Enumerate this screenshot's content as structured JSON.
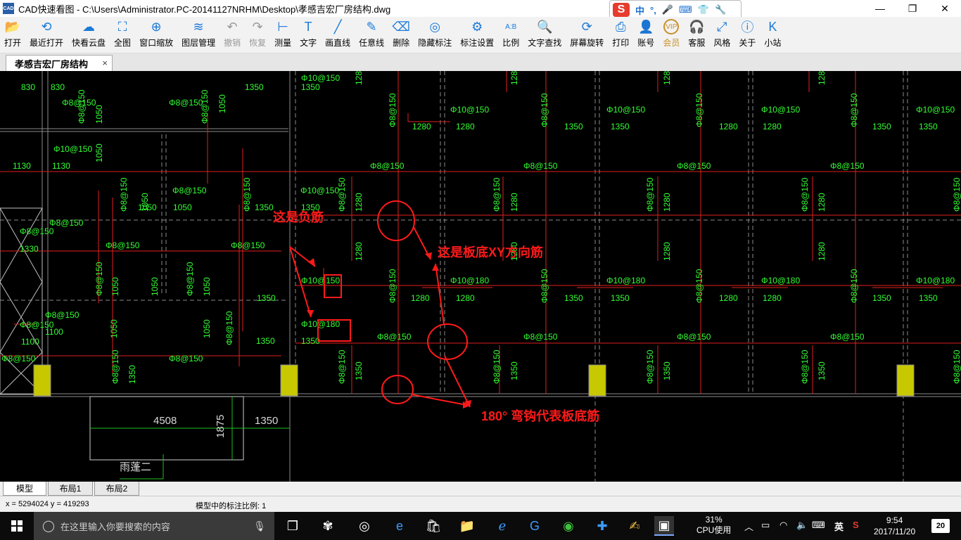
{
  "window": {
    "title": "CAD快速看图 - C:\\Users\\Administrator.PC-20141127NRHM\\Desktop\\孝感吉宏厂房结构.dwg",
    "app_icon_text": "CAD"
  },
  "ime": {
    "logo": "S",
    "lang": "中",
    "punct": "°,"
  },
  "toolbar": {
    "items": [
      {
        "label": "打开",
        "icon": "folder-open-icon",
        "glyph": "📂"
      },
      {
        "label": "最近打开",
        "icon": "history-icon",
        "glyph": "⟲"
      },
      {
        "label": "快看云盘",
        "icon": "cloud-icon",
        "glyph": "☁"
      },
      {
        "label": "全图",
        "icon": "fit-all-icon",
        "glyph": "⛶"
      },
      {
        "label": "窗口缩放",
        "icon": "zoom-window-icon",
        "glyph": "⊕"
      },
      {
        "label": "图层管理",
        "icon": "layers-icon",
        "glyph": "≋"
      },
      {
        "label": "撤销",
        "icon": "undo-icon",
        "glyph": "↶"
      },
      {
        "label": "恢复",
        "icon": "redo-icon",
        "glyph": "↷"
      },
      {
        "label": "测量",
        "icon": "ruler-icon",
        "glyph": "⊢"
      },
      {
        "label": "文字",
        "icon": "text-icon",
        "glyph": "T"
      },
      {
        "label": "画直线",
        "icon": "line-icon",
        "glyph": "╱"
      },
      {
        "label": "任意线",
        "icon": "pen-icon",
        "glyph": "✎"
      },
      {
        "label": "删除",
        "icon": "eraser-icon",
        "glyph": "⌫"
      },
      {
        "label": "隐藏标注",
        "icon": "eye-off-icon",
        "glyph": "◎"
      },
      {
        "label": "标注设置",
        "icon": "annotation-settings-icon",
        "glyph": "⚙"
      },
      {
        "label": "比例",
        "icon": "scale-icon",
        "glyph": "A:B"
      },
      {
        "label": "文字查找",
        "icon": "text-search-icon",
        "glyph": "🔍"
      },
      {
        "label": "屏幕旋转",
        "icon": "rotate-screen-icon",
        "glyph": "⟳"
      },
      {
        "label": "打印",
        "icon": "printer-icon",
        "glyph": "⎙"
      },
      {
        "label": "账号",
        "icon": "user-icon",
        "glyph": "👤"
      },
      {
        "label": "会员",
        "icon": "vip-icon",
        "glyph": "VIP"
      },
      {
        "label": "客服",
        "icon": "headset-icon",
        "glyph": "🎧"
      },
      {
        "label": "风格",
        "icon": "style-icon",
        "glyph": "⤢"
      },
      {
        "label": "关于",
        "icon": "info-icon",
        "glyph": "ⓘ"
      },
      {
        "label": "小站",
        "icon": "k-station-icon",
        "glyph": "K"
      }
    ]
  },
  "doc_tab": {
    "label": "孝感吉宏厂房结构",
    "close": "×"
  },
  "drawing": {
    "annotations": {
      "negative_bar": "这是负筋",
      "bottom_xy_bar": "这是板底XY方向筋",
      "hook_text": "180° 弯钩代表板底筋"
    },
    "labels": {
      "phi8_150": "Φ8@150",
      "phi10_150": "Φ10@150",
      "phi10_180": "Φ10@180",
      "d1350": "1350",
      "d1280": "1280",
      "d1050": "1050",
      "d1130": "1130",
      "d830": "830",
      "d1330": "1330",
      "d1100": "1100",
      "d4508": "4508",
      "d1875": "1875",
      "canopy": "雨蓬二"
    }
  },
  "layout_tabs": [
    "模型",
    "布局1",
    "布局2"
  ],
  "status": {
    "coords": "x = 5294024  y = 419293",
    "scale_text": "模型中的标注比例: 1"
  },
  "taskbar": {
    "search_placeholder": "在这里输入你要搜索的内容",
    "cpu_percent": "31%",
    "cpu_label": "CPU使用",
    "ime_lang": "英",
    "time": "9:54",
    "date": "2017/11/20",
    "notifications": "20"
  }
}
